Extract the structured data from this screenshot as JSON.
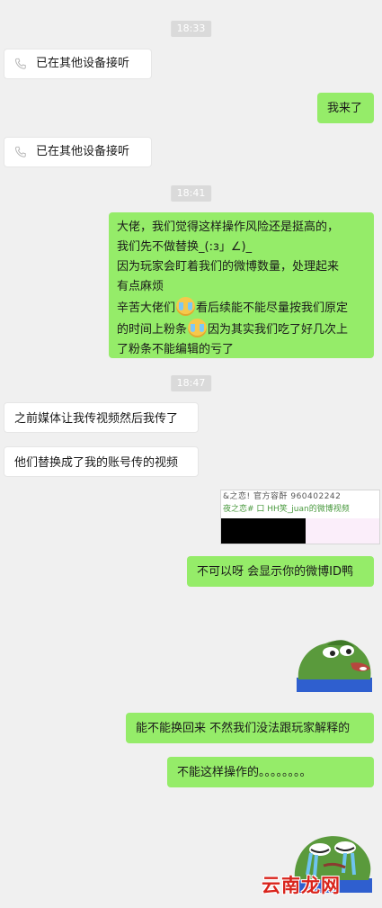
{
  "timestamps": [
    "18:33",
    "18:41",
    "18:47"
  ],
  "messages": {
    "call_notice_1": "已在其他设备接听",
    "me_coming": "我来了",
    "call_notice_2": "已在其他设备接听",
    "long_lines": [
      "大佬，我们觉得这样操作风险还是挺高的，",
      "我们先不做替换_(:з」∠)_",
      "因为玩家会盯着我们的微博数量，处理起来",
      "有点麻烦",
      "辛苦大佬们",
      "看后续能不能尽量按我们原定",
      "的时间上粉条",
      "因为其实我们吃了好几次上",
      "了粉条不能编辑的亏了"
    ],
    "media_request": "之前媒体让我传视频然后我传了",
    "replaced_account": "他们替换成了我的账号传的视频",
    "show_id": "不可以呀 会显示你的微博ID鸭",
    "change_back": "能不能换回来 不然我们没法跟玩家解释的",
    "cannot_do": "不能这样操作的。。。。。。。。"
  },
  "screenshot_text": {
    "line1": "&之恋! 官方容酐 960402242",
    "line2": "夜之恋#   口 HH笑_juan的微博视频"
  },
  "watermark": "云南龙网",
  "icons": {
    "call": "phone-icon",
    "emoji": "crying-face-icon",
    "sticker1": "pepe-frog-sticker",
    "sticker2": "crying-pepe-sticker"
  },
  "colors": {
    "background": "#f0f0f0",
    "bubble_self": "#95ec69",
    "bubble_other": "#ffffff",
    "timestamp_bg": "#dadada",
    "watermark": "#d9241c"
  }
}
